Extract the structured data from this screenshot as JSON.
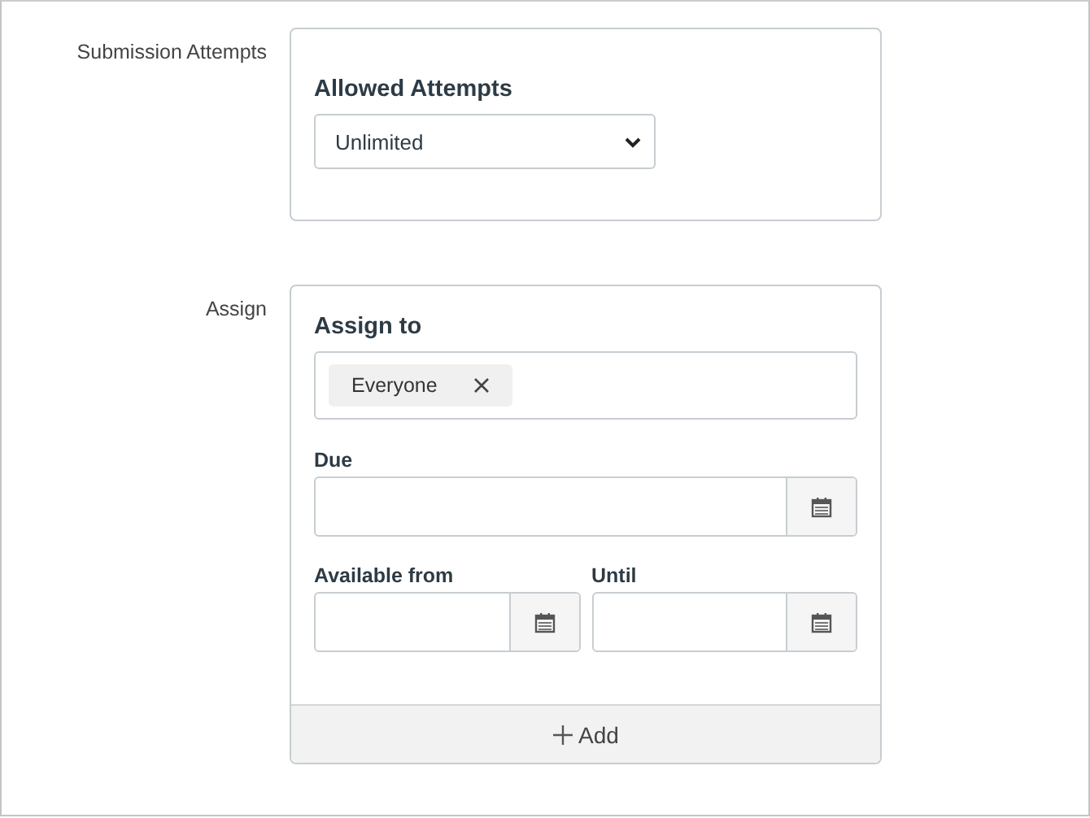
{
  "sections": [
    {
      "label": "Submission Attempts",
      "kind": "attempts",
      "heading": "Allowed Attempts",
      "select_value": "Unlimited"
    },
    {
      "label": "Assign",
      "kind": "assign",
      "heading": "Assign to",
      "tags": [
        "Everyone"
      ],
      "due_label": "Due",
      "from_label": "Available from",
      "until_label": "Until",
      "add_label": "Add"
    }
  ]
}
